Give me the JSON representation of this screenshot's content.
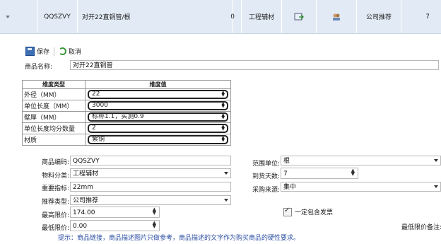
{
  "grid_row": {
    "code": "QQSZVY",
    "name": "对开22直铜管/根",
    "qty": "0",
    "category": "工程辅材",
    "icon1": "export-icon",
    "icon2": "users-icon",
    "source": "公司推荐",
    "count": "7"
  },
  "toolbar": {
    "save_label": "保存",
    "cancel_label": "取消"
  },
  "product_name": {
    "label": "商品名称:",
    "value": "对开22直铜管"
  },
  "dim_table": {
    "headers": [
      "维度类型",
      "维度值"
    ],
    "rows": [
      {
        "name": "外径（MM）",
        "value": "22"
      },
      {
        "name": "单位长度（MM）",
        "value": "3000"
      },
      {
        "name": "壁厚（MM）",
        "value": "标称1.1，实测0.9"
      },
      {
        "name": "单位长度均分数量",
        "value": "2"
      },
      {
        "name": "材质",
        "value": "紫铜"
      }
    ]
  },
  "form": {
    "code_label": "商品编码:",
    "code_value": "QQSZVY",
    "category_label": "物料分类:",
    "category_value": "工程辅材",
    "indicator_label": "重要指标:",
    "indicator_value": "22mm",
    "recommend_label": "推荐类型:",
    "recommend_value": "公司推荐",
    "max_price_label": "最高限价:",
    "max_price_value": "174.00",
    "min_price_label": "最低限价:",
    "min_price_value": "0.00",
    "scope_label": "范围单位:",
    "scope_value": "根",
    "days_label": "到货天数:",
    "days_value": "7",
    "procure_label": "采购来源:",
    "procure_value": "集中",
    "invoice_label": "一定包含发票",
    "min_note_label": "最低限价备注:",
    "tip": "提示：商品链接，商品描述图片只做参考，商品描述的文字作为购买商品的硬性要求。"
  }
}
